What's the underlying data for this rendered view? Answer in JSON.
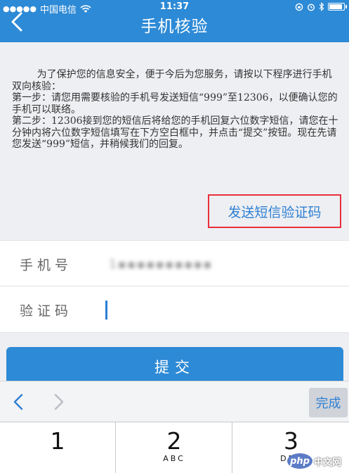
{
  "status_bar": {
    "carrier": "中国电信",
    "time": "11:37"
  },
  "nav": {
    "title": "手机核验"
  },
  "info": {
    "text": "        为了保护您的信息安全，便于今后为您服务，请按以下程序进行手机双向核验：\n第一步：请您用需要核验的手机号发送短信“999”至12306，以便确认您的手机可以联络。\n第二步：12306接到您的短信后将给您的手机回复六位数字短信，请您在十分钟内将六位数字短信填写在下方空白框中，并点击“提交”按钮。现在先请您发送“999”短信，并稍候我们的回复。"
  },
  "send_code_label": "发送短信验证码",
  "form": {
    "phone_label": "手机号",
    "phone_value": "1▪▪▪▪▪▪▪▪▪▪",
    "code_label": "验证码",
    "code_value": ""
  },
  "submit_label": "提交",
  "toolbar": {
    "done_label": "完成"
  },
  "keyboard": {
    "keys": [
      {
        "num": "1",
        "letters": ""
      },
      {
        "num": "2",
        "letters": "ABC"
      },
      {
        "num": "3",
        "letters": "DEF"
      }
    ]
  },
  "watermark": {
    "logo": "php",
    "text": "中文网"
  },
  "colors": {
    "brand_blue": "#2d8ad6",
    "highlight_red": "#e8303c",
    "link_blue": "#2d7fd3"
  }
}
